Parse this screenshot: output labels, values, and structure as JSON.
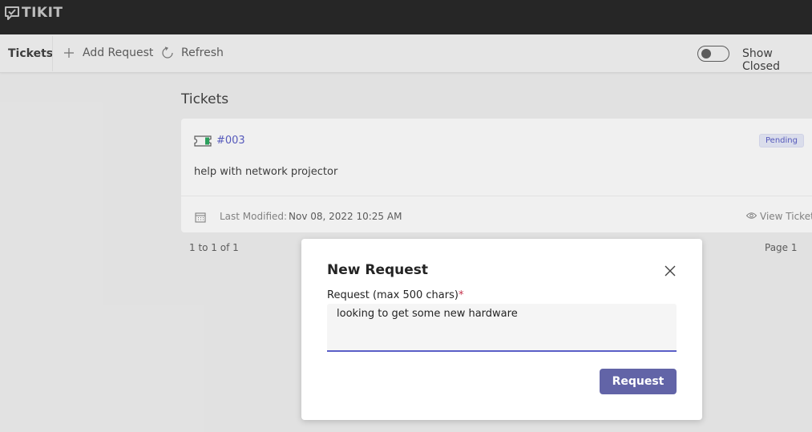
{
  "app": {
    "logo_text": "TIKIT",
    "logo_icon": "chat-check-icon"
  },
  "toolbar": {
    "title": "Tickets",
    "add_label": "Add Request",
    "refresh_label": "Refresh",
    "show_closed_label": "Show Closed",
    "show_closed_on": false
  },
  "main": {
    "section_title": "Tickets",
    "tickets": [
      {
        "id": "#003",
        "status": "Pending",
        "description": "help with network projector",
        "last_modified_label": "Last Modified:",
        "last_modified": "Nov 08, 2022 10:25 AM",
        "view_label": "View Ticket"
      }
    ],
    "pager_summary": "1 to 1 of 1",
    "pager_page": "Page 1"
  },
  "dialog": {
    "title": "New Request",
    "field_label": "Request (max 500 chars)",
    "required_mark": "*",
    "field_value": "looking to get some new hardware",
    "submit_label": "Request"
  },
  "colors": {
    "accent": "#5b5fc7",
    "button": "#6264a7",
    "appbar": "#292929",
    "required": "#c4314b"
  }
}
